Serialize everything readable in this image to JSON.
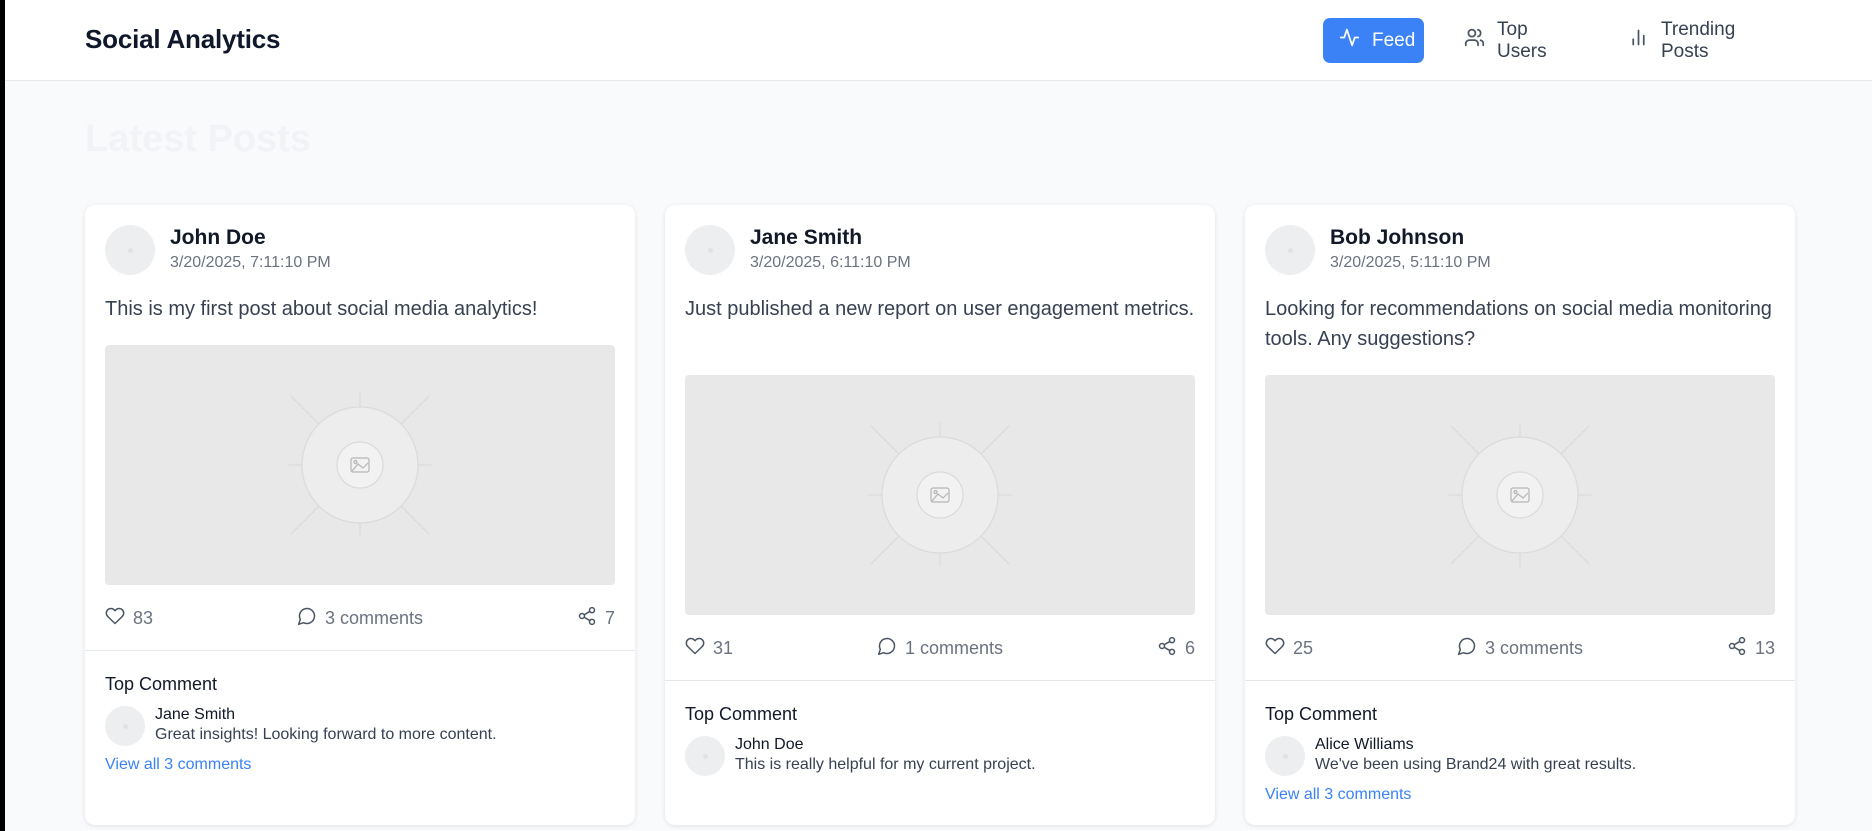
{
  "app": {
    "title": "Social Analytics"
  },
  "nav": {
    "feed": {
      "label": "Feed",
      "icon": "activity-icon",
      "active": true
    },
    "top_users": {
      "label": "Top Users",
      "icon": "users-icon"
    },
    "trending": {
      "label": "Trending Posts",
      "icon": "bar-chart-icon"
    }
  },
  "section": {
    "title": "Latest Posts"
  },
  "colors": {
    "accent": "#3b82f6",
    "background": "#f8fafc",
    "card": "#ffffff"
  },
  "posts": [
    {
      "author": "John Doe",
      "time": "3/20/2025, 7:11:10 PM",
      "content": "This is my first post about social media analytics!",
      "likes": "83",
      "comments": "3 comments",
      "shares": "7",
      "top_comment_label": "Top Comment",
      "top_comment": {
        "author": "Jane Smith",
        "text": "Great insights! Looking forward to more content."
      },
      "view_all": "View all 3 comments"
    },
    {
      "author": "Jane Smith",
      "time": "3/20/2025, 6:11:10 PM",
      "content": "Just published a new report on user engagement metrics.",
      "likes": "31",
      "comments": "1 comments",
      "shares": "6",
      "top_comment_label": "Top Comment",
      "top_comment": {
        "author": "John Doe",
        "text": "This is really helpful for my current project."
      }
    },
    {
      "author": "Bob Johnson",
      "time": "3/20/2025, 5:11:10 PM",
      "content": "Looking for recommendations on social media monitoring tools. Any suggestions?",
      "likes": "25",
      "comments": "3 comments",
      "shares": "13",
      "top_comment_label": "Top Comment",
      "top_comment": {
        "author": "Alice Williams",
        "text": "We've been using Brand24 with great results."
      },
      "view_all": "View all 3 comments"
    }
  ]
}
